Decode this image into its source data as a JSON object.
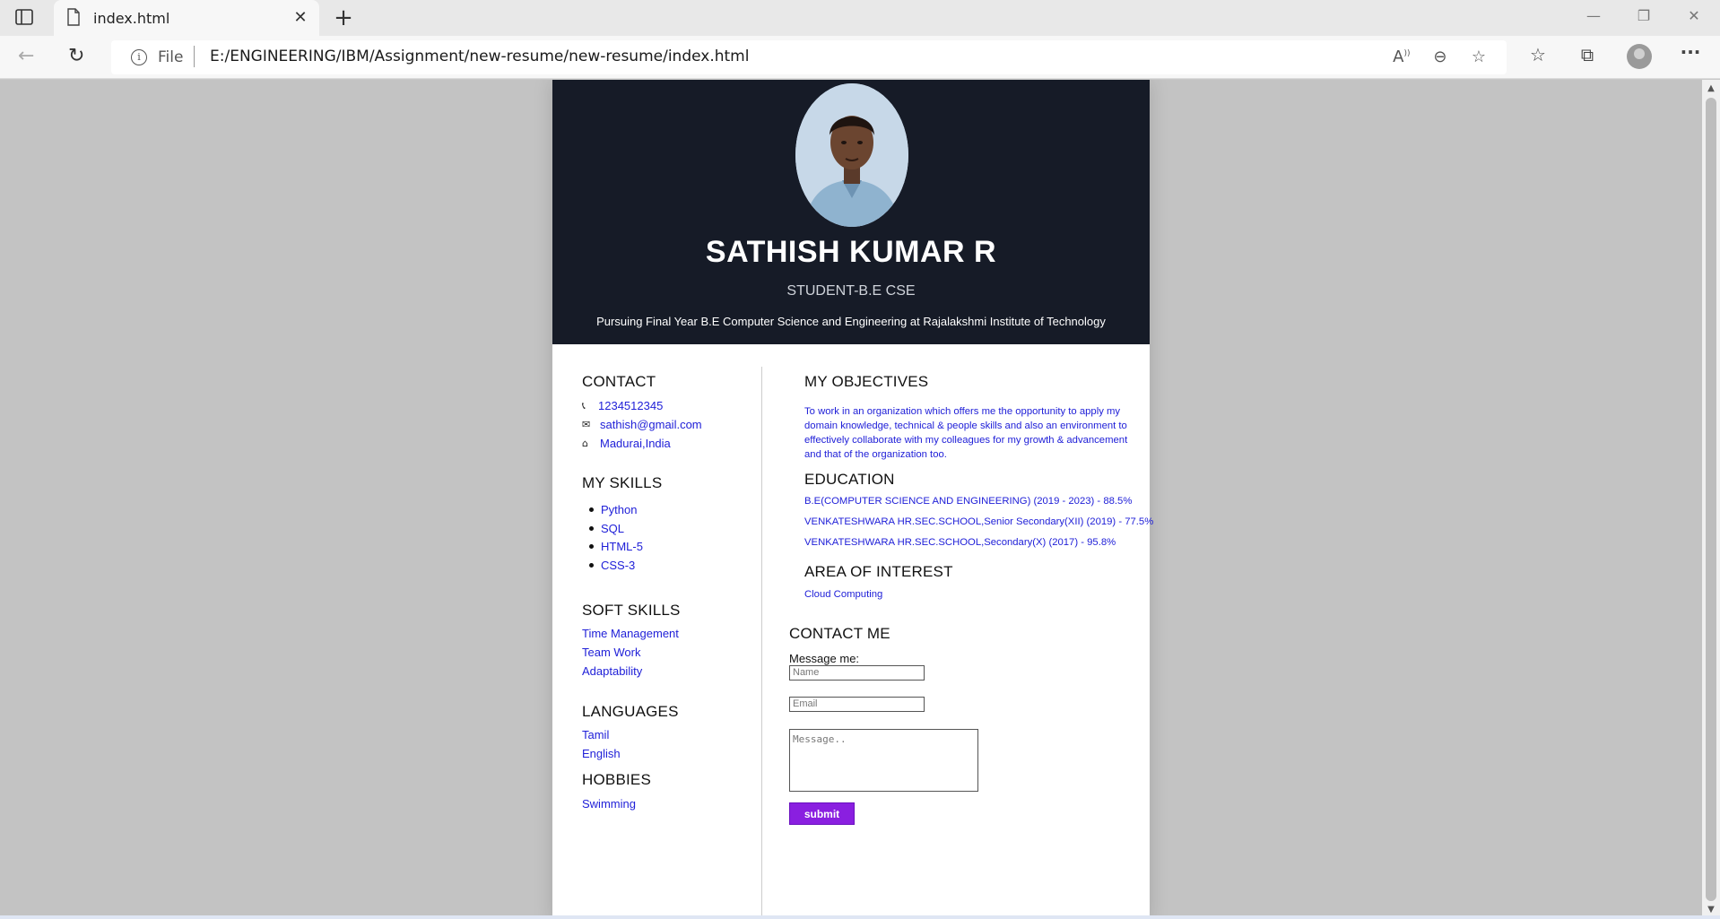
{
  "browser": {
    "tab_title": "index.html",
    "tab_close": "✕",
    "new_tab": "+",
    "url_scheme": "File",
    "url_path": "E:/ENGINEERING/IBM/Assignment/new-resume/new-resume/index.html",
    "icons": [
      "sidebar-icon",
      "page-icon",
      "back-icon",
      "reload-icon",
      "info-icon",
      "read-aloud-icon",
      "zoom-out-icon",
      "add-favorite-icon",
      "favorites-icon",
      "collections-icon",
      "profile-icon",
      "more-icon"
    ]
  },
  "header": {
    "name": "SATHISH KUMAR R",
    "role": "STUDENT-B.E CSE",
    "tagline": "Pursuing Final Year B.E Computer Science and Engineering at Rajalakshmi Institute of Technology"
  },
  "contact": {
    "title": "CONTACT",
    "phone": "1234512345",
    "email": "sathish@gmail.com",
    "location": "Madurai,India"
  },
  "skills": {
    "title": "MY SKILLS",
    "items": [
      "Python",
      "SQL",
      "HTML-5",
      "CSS-3"
    ]
  },
  "soft_skills": {
    "title": "SOFT SKILLS",
    "items": [
      "Time Management",
      "Team Work",
      "Adaptability"
    ]
  },
  "languages": {
    "title": "LANGUAGES",
    "items": [
      "Tamil",
      "English"
    ]
  },
  "hobbies": {
    "title": "HOBBIES",
    "items": [
      "Swimming"
    ]
  },
  "objectives": {
    "title": "MY OBJECTIVES",
    "text": "To work in an organization which offers me the opportunity to apply my domain knowledge, technical & people skills and also an environment to effectively collaborate with my colleagues for my growth & advancement and that of the organization too."
  },
  "education": {
    "title": "EDUCATION",
    "items": [
      "B.E(COMPUTER SCIENCE AND ENGINEERING) (2019 - 2023) - 88.5%",
      "VENKATESHWARA HR.SEC.SCHOOL,Senior Secondary(XII) (2019) - 77.5%",
      "VENKATESHWARA HR.SEC.SCHOOL,Secondary(X) (2017) - 95.8%"
    ]
  },
  "interest": {
    "title": "AREA OF INTEREST",
    "items": [
      "Cloud Computing"
    ]
  },
  "contact_form": {
    "title": "CONTACT ME",
    "label": "Message me:",
    "name_placeholder": "Name",
    "email_placeholder": "Email",
    "message_placeholder": "Message..",
    "submit_label": "submit"
  },
  "colors": {
    "header_bg": "#161b27",
    "link_blue": "#2020d8",
    "submit_purple": "#8a1fe0",
    "page_bg": "#c3c3c3"
  }
}
